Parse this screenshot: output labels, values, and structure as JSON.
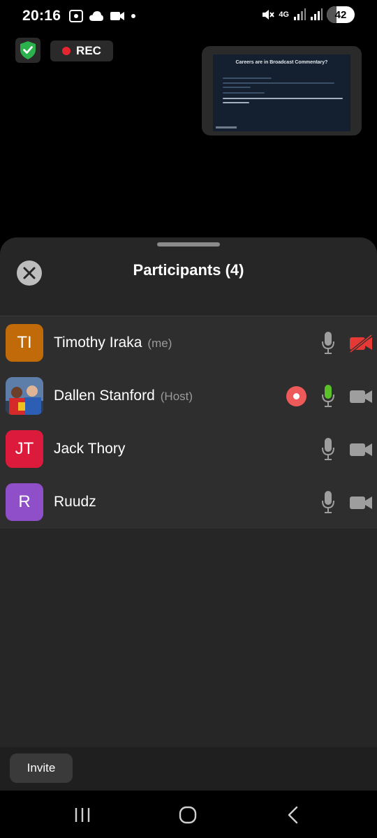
{
  "status_bar": {
    "time": "20:16",
    "network": "4G",
    "battery": "42"
  },
  "meeting": {
    "rec_label": "REC",
    "shared_slide_title": "Careers are in Broadcast Commentary?"
  },
  "panel": {
    "title": "Participants (4)",
    "invite_label": "Invite"
  },
  "participants": [
    {
      "initials": "TI",
      "name": "Timothy Iraka",
      "tag": "(me)",
      "avatar_color": "#c16a0a",
      "mic": "muted",
      "video": "off"
    },
    {
      "initials": "",
      "name": "Dallen Stanford",
      "tag": "(Host)",
      "avatar_color": "#4a6c96",
      "mic": "active",
      "video": "on",
      "recording": true
    },
    {
      "initials": "JT",
      "name": "Jack Thory",
      "tag": "",
      "avatar_color": "#dc1b3c",
      "mic": "muted",
      "video": "on"
    },
    {
      "initials": "R",
      "name": "Ruudz",
      "tag": "",
      "avatar_color": "#8f4fc8",
      "mic": "muted",
      "video": "on"
    }
  ],
  "icons": [
    "shield-check-icon",
    "record-dot-icon",
    "close-icon",
    "microphone-icon",
    "video-camera-icon",
    "video-off-icon",
    "recents-icon",
    "home-icon",
    "back-icon"
  ],
  "colors": {
    "accent_green": "#5bbf2a",
    "record_red": "#e5262f",
    "video_off_red": "#e53935",
    "sheet_bg": "#262626"
  }
}
